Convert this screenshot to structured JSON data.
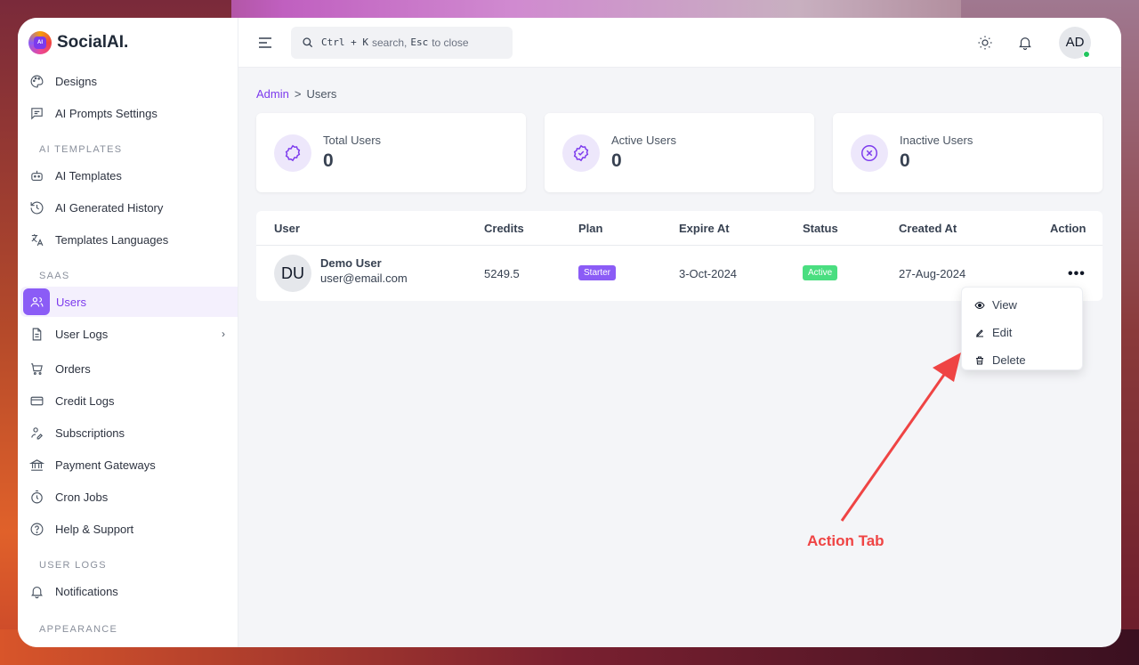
{
  "brand": {
    "name": "SocialAI.",
    "logo_text": "AI"
  },
  "sidebar": {
    "items_top": [
      {
        "label": "Designs",
        "icon": "palette-icon"
      },
      {
        "label": "AI Prompts Settings",
        "icon": "chat-icon"
      }
    ],
    "section_ai": "AI TEMPLATES",
    "items_ai": [
      {
        "label": "AI Templates",
        "icon": "robot-icon"
      },
      {
        "label": "AI Generated History",
        "icon": "history-icon"
      },
      {
        "label": "Templates Languages",
        "icon": "translate-icon"
      }
    ],
    "section_saas": "SAAS",
    "items_saas": [
      {
        "label": "Users",
        "icon": "users-icon",
        "active": true
      },
      {
        "label": "User Logs",
        "icon": "file-icon",
        "chevron": "›"
      },
      {
        "label": "Orders",
        "icon": "cart-icon"
      },
      {
        "label": "Credit Logs",
        "icon": "card-icon"
      },
      {
        "label": "Subscriptions",
        "icon": "user-sign-icon"
      },
      {
        "label": "Payment Gateways",
        "icon": "bank-icon"
      },
      {
        "label": "Cron Jobs",
        "icon": "timer-icon"
      },
      {
        "label": "Help & Support",
        "icon": "help-icon"
      }
    ],
    "section_logs": "USER LOGS",
    "items_logs": [
      {
        "label": "Notifications",
        "icon": "bell-icon"
      }
    ],
    "section_appearance": "APPEARANCE"
  },
  "topbar": {
    "search_kbd1": "Ctrl + K",
    "search_text1": "search,",
    "search_kbd2": "Esc",
    "search_text2": "to close",
    "avatar": "AD"
  },
  "breadcrumb": {
    "root": "Admin",
    "sep": ">",
    "current": "Users"
  },
  "stats": [
    {
      "label": "Total Users",
      "value": "0",
      "icon": "badge-icon"
    },
    {
      "label": "Active Users",
      "value": "0",
      "icon": "badge-check-icon"
    },
    {
      "label": "Inactive Users",
      "value": "0",
      "icon": "x-circle-icon"
    }
  ],
  "table": {
    "headers": {
      "user": "User",
      "credits": "Credits",
      "plan": "Plan",
      "expire": "Expire At",
      "status": "Status",
      "created": "Created At",
      "action": "Action"
    },
    "row": {
      "initials": "DU",
      "name": "Demo User",
      "email": "user@email.com",
      "credits": "5249.5",
      "plan": "Starter",
      "expire": "3-Oct-2024",
      "status": "Active",
      "created": "27-Aug-2024",
      "action": "•••"
    }
  },
  "dropdown": {
    "view": "View",
    "edit": "Edit",
    "delete": "Delete"
  },
  "annotation": {
    "label": "Action Tab"
  },
  "colors": {
    "accent": "#8b5cf6",
    "plan_badge": "#8b5cf6",
    "status_badge": "#22c55e",
    "annotation": "#ef4444"
  }
}
